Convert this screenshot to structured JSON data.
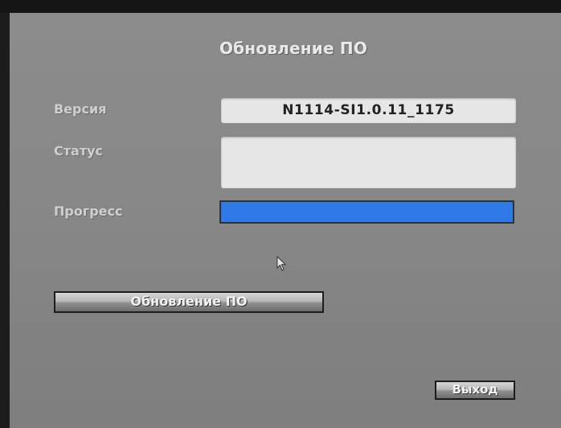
{
  "window": {
    "title": "Обновление ПО"
  },
  "form": {
    "version_label": "Версия",
    "version_value": "N1114-SI1.0.11_1175",
    "status_label": "Статус",
    "status_value": "",
    "progress_label": "Прогресс",
    "progress_fraction": 1.0
  },
  "buttons": {
    "update_label": "Обновление ПО",
    "exit_label": "Выход"
  },
  "colors": {
    "progress_fill": "#2e7ae6",
    "background": "#878787"
  },
  "icons": {
    "cursor": "mouse-pointer-icon"
  }
}
